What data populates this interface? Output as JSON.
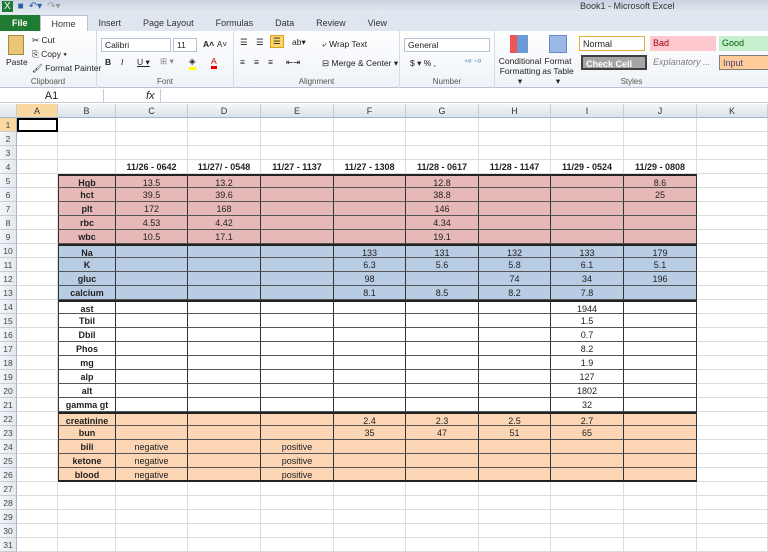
{
  "window": {
    "title": "Book1  -  Microsoft Excel"
  },
  "tabs": [
    "File",
    "Home",
    "Insert",
    "Page Layout",
    "Formulas",
    "Data",
    "Review",
    "View"
  ],
  "ribbon": {
    "clipboard": {
      "paste": "Paste",
      "cut": "Cut",
      "copy": "Copy ▾",
      "format_painter": "Format Painter",
      "label": "Clipboard"
    },
    "font": {
      "name": "Calibri",
      "size": "11",
      "label": "Font"
    },
    "alignment": {
      "wrap": "Wrap Text",
      "merge": "Merge & Center ▾",
      "label": "Alignment"
    },
    "number": {
      "format": "General",
      "label": "Number"
    },
    "styles": {
      "conditional": "Conditional Formatting ▾",
      "format_table": "Format as Table ▾",
      "normal": "Normal",
      "bad": "Bad",
      "good": "Good",
      "check": "Check Cell",
      "explanatory": "Explanatory ...",
      "input": "Input",
      "label": "Styles"
    }
  },
  "formula_bar": {
    "name_box": "A1",
    "fx": "fx",
    "value": ""
  },
  "columns": [
    "A",
    "B",
    "C",
    "D",
    "E",
    "F",
    "G",
    "H",
    "I",
    "J",
    "K"
  ],
  "colors": {
    "pink": "#e6b8b7",
    "blue": "#b8cce4",
    "orange": "#fcd5b4"
  },
  "sheet": {
    "headers": [
      "",
      "",
      "11/26 - 0642",
      "11/27/ - 0548",
      "11/27 - 1137",
      "11/27 - 1308",
      "11/28 - 0617",
      "11/28 - 1147",
      "11/29 - 0524",
      "11/29 - 0808",
      ""
    ],
    "rows": [
      {
        "g": "pink",
        "c": [
          "Hgb",
          "13.5",
          "13.2",
          "",
          "",
          "12.8",
          "",
          "",
          "8.6"
        ]
      },
      {
        "g": "pink",
        "c": [
          "hct",
          "39.5",
          "39.6",
          "",
          "",
          "38.8",
          "",
          "",
          "25"
        ]
      },
      {
        "g": "pink",
        "c": [
          "plt",
          "172",
          "168",
          "",
          "",
          "146",
          "",
          "",
          ""
        ]
      },
      {
        "g": "pink",
        "c": [
          "rbc",
          "4.53",
          "4.42",
          "",
          "",
          "4.34",
          "",
          "",
          ""
        ]
      },
      {
        "g": "pink",
        "c": [
          "wbc",
          "10.5",
          "17.1",
          "",
          "",
          "19.1",
          "",
          "",
          ""
        ]
      },
      {
        "g": "blue",
        "c": [
          "Na",
          "",
          "",
          "",
          "133",
          "131",
          "132",
          "133",
          "179"
        ]
      },
      {
        "g": "blue",
        "c": [
          "K",
          "",
          "",
          "",
          "6.3",
          "5.6",
          "5.8",
          "6.1",
          "5.1"
        ]
      },
      {
        "g": "blue",
        "c": [
          "gluc",
          "",
          "",
          "",
          "98",
          "",
          "74",
          "34",
          "196"
        ]
      },
      {
        "g": "blue",
        "c": [
          "calcium",
          "",
          "",
          "",
          "8.1",
          "8.5",
          "8.2",
          "7.8",
          ""
        ]
      },
      {
        "g": "white",
        "c": [
          "ast",
          "",
          "",
          "",
          "",
          "",
          "",
          "1944",
          ""
        ]
      },
      {
        "g": "white",
        "c": [
          "Tbil",
          "",
          "",
          "",
          "",
          "",
          "",
          "1.5",
          ""
        ]
      },
      {
        "g": "white",
        "c": [
          "Dbil",
          "",
          "",
          "",
          "",
          "",
          "",
          "0.7",
          ""
        ]
      },
      {
        "g": "white",
        "c": [
          "Phos",
          "",
          "",
          "",
          "",
          "",
          "",
          "8.2",
          ""
        ]
      },
      {
        "g": "white",
        "c": [
          "mg",
          "",
          "",
          "",
          "",
          "",
          "",
          "1.9",
          ""
        ]
      },
      {
        "g": "white",
        "c": [
          "alp",
          "",
          "",
          "",
          "",
          "",
          "",
          "127",
          ""
        ]
      },
      {
        "g": "white",
        "c": [
          "alt",
          "",
          "",
          "",
          "",
          "",
          "",
          "1802",
          ""
        ]
      },
      {
        "g": "white",
        "c": [
          "gamma gt",
          "",
          "",
          "",
          "",
          "",
          "",
          "32",
          ""
        ]
      },
      {
        "g": "orange",
        "c": [
          "creatinine",
          "",
          "",
          "",
          "2.4",
          "2.3",
          "2.5",
          "2.7",
          ""
        ]
      },
      {
        "g": "orange",
        "c": [
          "bun",
          "",
          "",
          "",
          "35",
          "47",
          "51",
          "65",
          ""
        ]
      },
      {
        "g": "orange",
        "c": [
          "bili",
          "negative",
          "",
          "positive",
          "",
          "",
          "",
          "",
          ""
        ]
      },
      {
        "g": "orange",
        "c": [
          "ketone",
          "negative",
          "",
          "positive",
          "",
          "",
          "",
          "",
          ""
        ]
      },
      {
        "g": "orange",
        "c": [
          "blood",
          "negative",
          "",
          "positive",
          "",
          "",
          "",
          "",
          ""
        ]
      }
    ]
  }
}
